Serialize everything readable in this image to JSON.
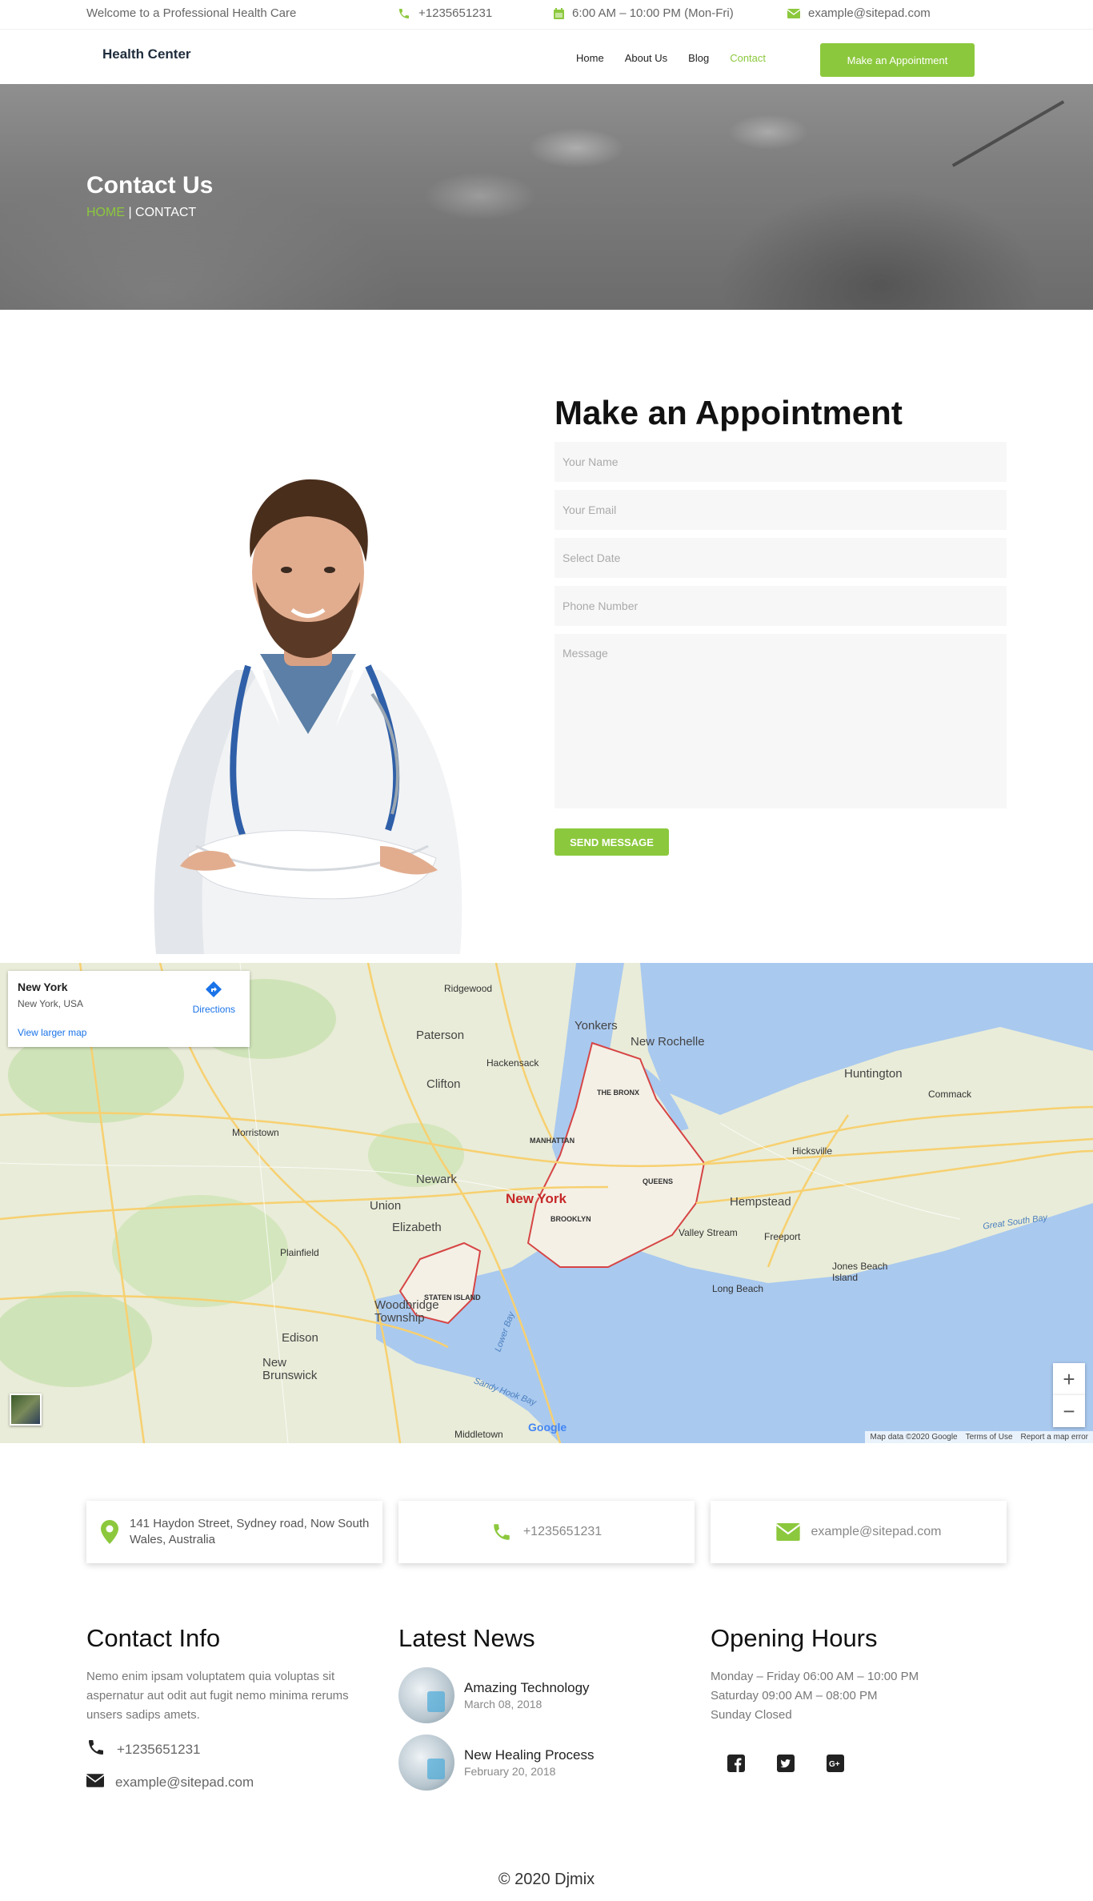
{
  "topbar": {
    "welcome": "Welcome to a Professional Health Care",
    "phone": "+1235651231",
    "hours": "6:00 AM – 10:00 PM (Mon-Fri)",
    "email": "example@sitepad.com"
  },
  "navbar": {
    "brand": "Health Center",
    "links": [
      "Home",
      "About Us",
      "Blog",
      "Contact"
    ],
    "active": "Contact",
    "cta": "Make an Appointment"
  },
  "hero": {
    "title": "Contact Us",
    "crumb_home": "HOME",
    "crumb_sep": " | ",
    "crumb_current": "CONTACT"
  },
  "appointment": {
    "title": "Make an Appointment",
    "name_placeholder": "Your Name",
    "email_placeholder": "Your Email",
    "date_placeholder": "Select Date",
    "phone_placeholder": "Phone Number",
    "message_placeholder": "Message",
    "submit": "SEND MESSAGE"
  },
  "map": {
    "card_title": "New York",
    "card_sub": "New York, USA",
    "card_link": "View larger map",
    "directions": "Directions",
    "zoom_in": "+",
    "zoom_out": "−",
    "attribution": [
      "Map data ©2020 Google",
      "Terms of Use",
      "Report a map error"
    ],
    "logo": "Google",
    "labels": {
      "new_york": "New York",
      "yonkers": "Yonkers",
      "new_rochelle": "New Rochelle",
      "paterson": "Paterson",
      "clifton": "Clifton",
      "newark": "Newark",
      "elizabeth": "Elizabeth",
      "union": "Union",
      "edison": "Edison",
      "new_brunswick": "New\nBrunswick",
      "hempstead": "Hempstead",
      "huntington": "Huntington",
      "freeport": "Freeport",
      "long_beach": "Long Beach",
      "jones_beach": "Jones Beach\nIsland",
      "bronx": "THE BRONX",
      "manhattan": "MANHATTAN",
      "queens": "QUEENS",
      "brooklyn": "BROOKLYN",
      "staten": "STATEN ISLAND",
      "morristown": "Morristown",
      "hackensack": "Hackensack",
      "woodbridge": "Woodbridge\nTownship",
      "middletown": "Middletown",
      "commack": "Commack",
      "hicksville": "Hicksville",
      "ridgewood": "Ridgewood",
      "plainfield": "Plainfield",
      "valley_stream": "Valley Stream",
      "great_south_bay": "Great South Bay",
      "lower_bay": "Lower Bay",
      "sandy_hook": "Sandy Hook Bay"
    }
  },
  "contact_boxes": {
    "address": "141 Haydon Street, Sydney road, Now South Wales, Australia",
    "phone": "+1235651231",
    "email": "example@sitepad.com"
  },
  "footer": {
    "contact_title": "Contact Info",
    "contact_desc": " Nemo enim ipsam voluptatem quia voluptas sit aspernatur aut odit aut fugit nemo minima rerums unsers sadips amets.",
    "contact_phone": "+1235651231",
    "contact_email": "example@sitepad.com",
    "news_title": "Latest News",
    "news": [
      {
        "title": "Amazing Technology",
        "date": "March 08, 2018"
      },
      {
        "title": "New Healing Process",
        "date": "February 20, 2018"
      }
    ],
    "hours_title": "Opening Hours",
    "hours": [
      "Monday – Friday 06:00 AM – 10:00 PM",
      "Saturday 09:00 AM – 08:00 PM",
      "Sunday Closed"
    ],
    "social": [
      "facebook-icon",
      "twitter-icon",
      "google-plus-icon"
    ],
    "copyright": "© 2020 Djmix"
  },
  "colors": {
    "accent": "#8cc83d",
    "heading": "#111111",
    "text_muted": "#777777"
  }
}
